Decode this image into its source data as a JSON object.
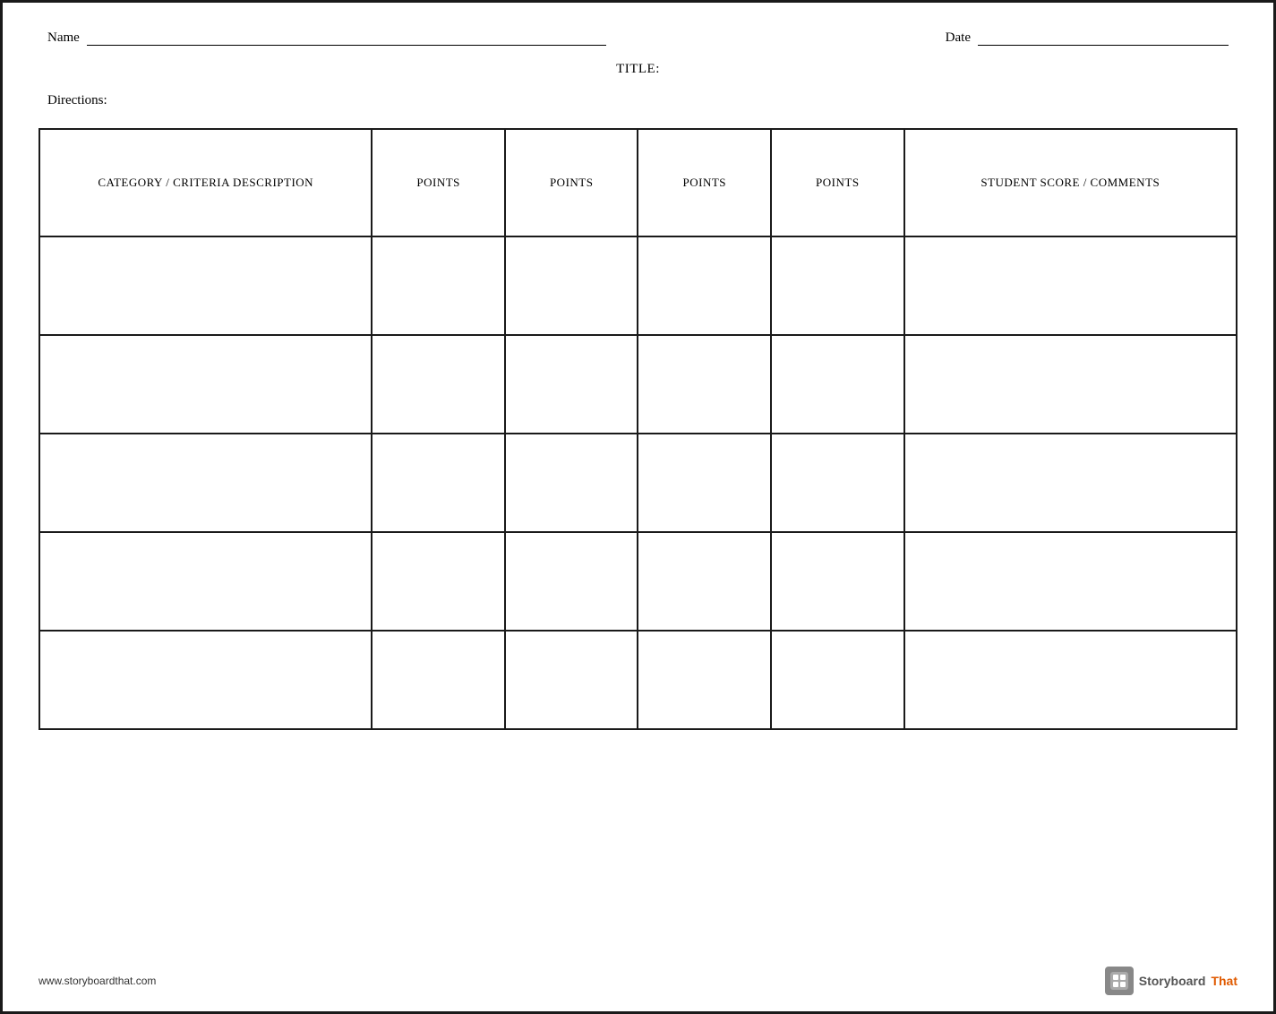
{
  "header": {
    "name_label": "Name",
    "date_label": "Date",
    "title_label": "TITLE:"
  },
  "directions": {
    "label": "Directions:"
  },
  "table": {
    "columns": [
      {
        "id": "category",
        "label": "CATEGORY / CRITERIA DESCRIPTION"
      },
      {
        "id": "points1",
        "label": "POINTS"
      },
      {
        "id": "points2",
        "label": "POINTS"
      },
      {
        "id": "points3",
        "label": "POINTS"
      },
      {
        "id": "points4",
        "label": "POINTS"
      },
      {
        "id": "student_score",
        "label": "STUDENT SCORE / COMMENTS"
      }
    ],
    "rows": [
      {
        "cells": [
          "",
          "",
          "",
          "",
          "",
          ""
        ]
      },
      {
        "cells": [
          "",
          "",
          "",
          "",
          "",
          ""
        ]
      },
      {
        "cells": [
          "",
          "",
          "",
          "",
          "",
          ""
        ]
      },
      {
        "cells": [
          "",
          "",
          "",
          "",
          "",
          ""
        ]
      },
      {
        "cells": [
          "",
          "",
          "",
          "",
          "",
          ""
        ]
      }
    ]
  },
  "footer": {
    "url": "www.storyboardthat.com",
    "logo_storyboard": "Storyboard",
    "logo_that": "That"
  }
}
